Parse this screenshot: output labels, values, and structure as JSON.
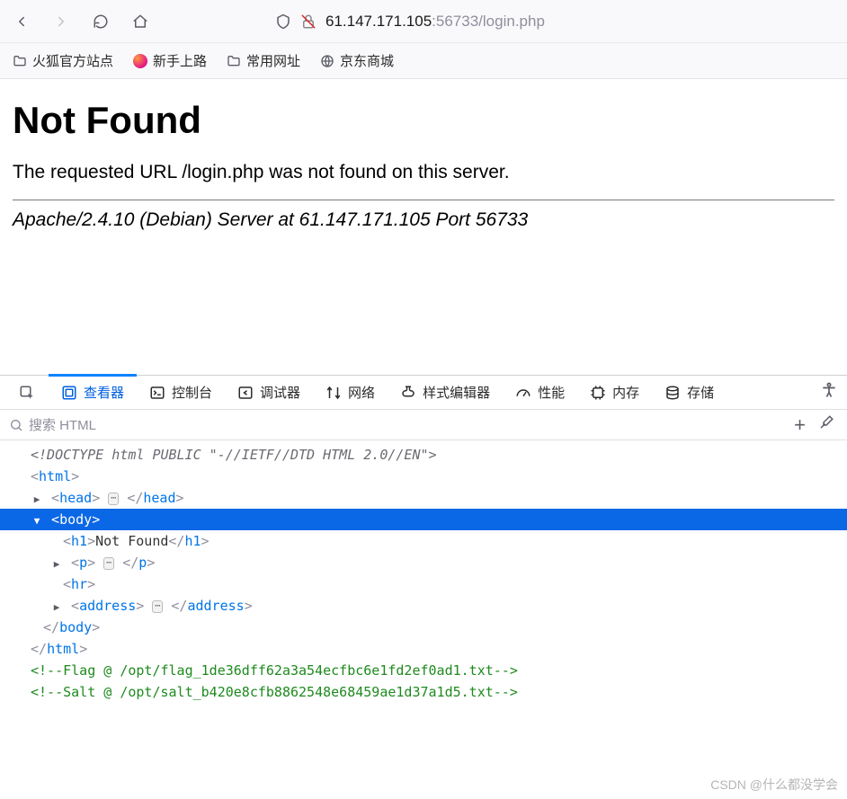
{
  "toolbar": {
    "url_host": "61.147.171.105",
    "url_port": ":56733",
    "url_path": "/login.php"
  },
  "bookmarks": [
    {
      "type": "folder",
      "label": "火狐官方站点"
    },
    {
      "type": "firefox",
      "label": "新手上路"
    },
    {
      "type": "folder",
      "label": "常用网址"
    },
    {
      "type": "globe",
      "label": "京东商城"
    }
  ],
  "page": {
    "heading": "Not Found",
    "message": "The requested URL /login.php was not found on this server.",
    "server_line": "Apache/2.4.10 (Debian) Server at 61.147.171.105 Port 56733"
  },
  "devtools": {
    "tabs": [
      {
        "key": "inspector",
        "label": "查看器",
        "active": true
      },
      {
        "key": "console",
        "label": "控制台"
      },
      {
        "key": "debugger",
        "label": "调试器"
      },
      {
        "key": "network",
        "label": "网络"
      },
      {
        "key": "style",
        "label": "样式编辑器"
      },
      {
        "key": "perf",
        "label": "性能"
      },
      {
        "key": "memory",
        "label": "内存"
      },
      {
        "key": "storage",
        "label": "存储"
      }
    ],
    "search_placeholder": "搜索 HTML",
    "tree": {
      "doctype": "<!DOCTYPE html PUBLIC \"-//IETF//DTD HTML 2.0//EN\">",
      "html_open": "html",
      "head": "head",
      "body": "body",
      "h1_text": "Not Found",
      "p": "p",
      "hr": "hr",
      "address": "address",
      "html_close": "html",
      "comment_flag": "<!--Flag @ /opt/flag_1de36dff62a3a54ecfbc6e1fd2ef0ad1.txt-->",
      "comment_salt": "<!--Salt @ /opt/salt_b420e8cfb8862548e68459ae1d37a1d5.txt-->"
    }
  },
  "watermark": "CSDN @什么都没学会"
}
